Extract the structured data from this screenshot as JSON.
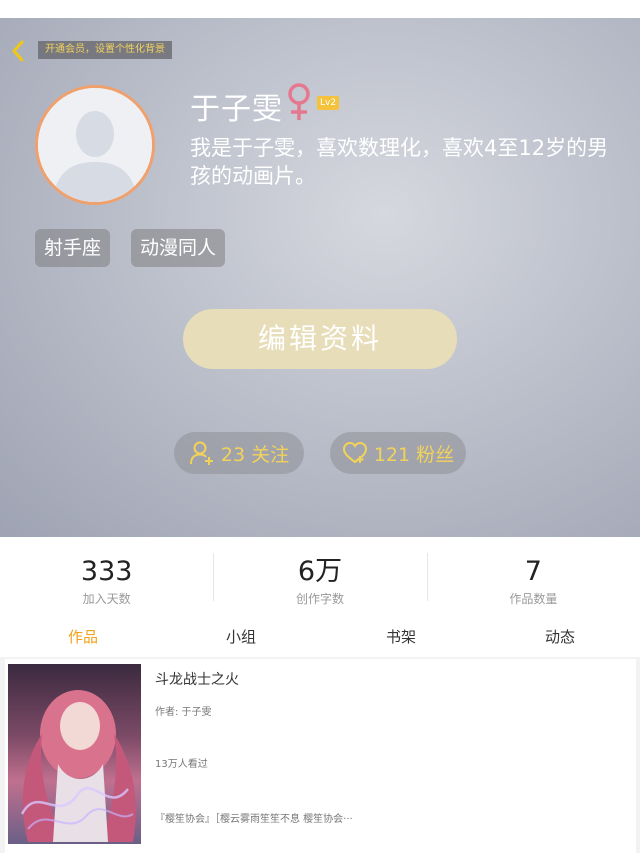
{
  "header": {
    "vip_banner": "开通会员，设置个性化背景",
    "username": "于子雯",
    "gender": "female",
    "level": "Lv2",
    "bio": "我是于子雯，喜欢数理化，喜欢4至12岁的男孩的动画片。",
    "tags": [
      "射手座",
      "动漫同人"
    ],
    "edit_button": "编辑资料",
    "follow_label": "23 关注",
    "fans_label": "121 粉丝",
    "icons": [
      "back-arrow-icon",
      "female-icon",
      "add-user-icon",
      "heart-icon"
    ]
  },
  "stats": [
    {
      "value": "333",
      "label": "加入天数"
    },
    {
      "value": "6万",
      "label": "创作字数"
    },
    {
      "value": "7",
      "label": "作品数量"
    }
  ],
  "tabs": [
    {
      "label": "作品",
      "active": true
    },
    {
      "label": "小组",
      "active": false
    },
    {
      "label": "书架",
      "active": false
    },
    {
      "label": "动态",
      "active": false
    }
  ],
  "work": {
    "title": "斗龙战士之火",
    "author": "作者: 于子雯",
    "views": "13万人看过",
    "description": "『樱笙协会』［樱云雾雨笙笙不息 樱笙协会···"
  },
  "colors": {
    "accent_yellow": "#f3d25a",
    "active_tab": "#f0a21a",
    "edit_button": "#e7ddb8",
    "avatar_border": "#f0a06c",
    "gender_icon": "#e5788f"
  }
}
